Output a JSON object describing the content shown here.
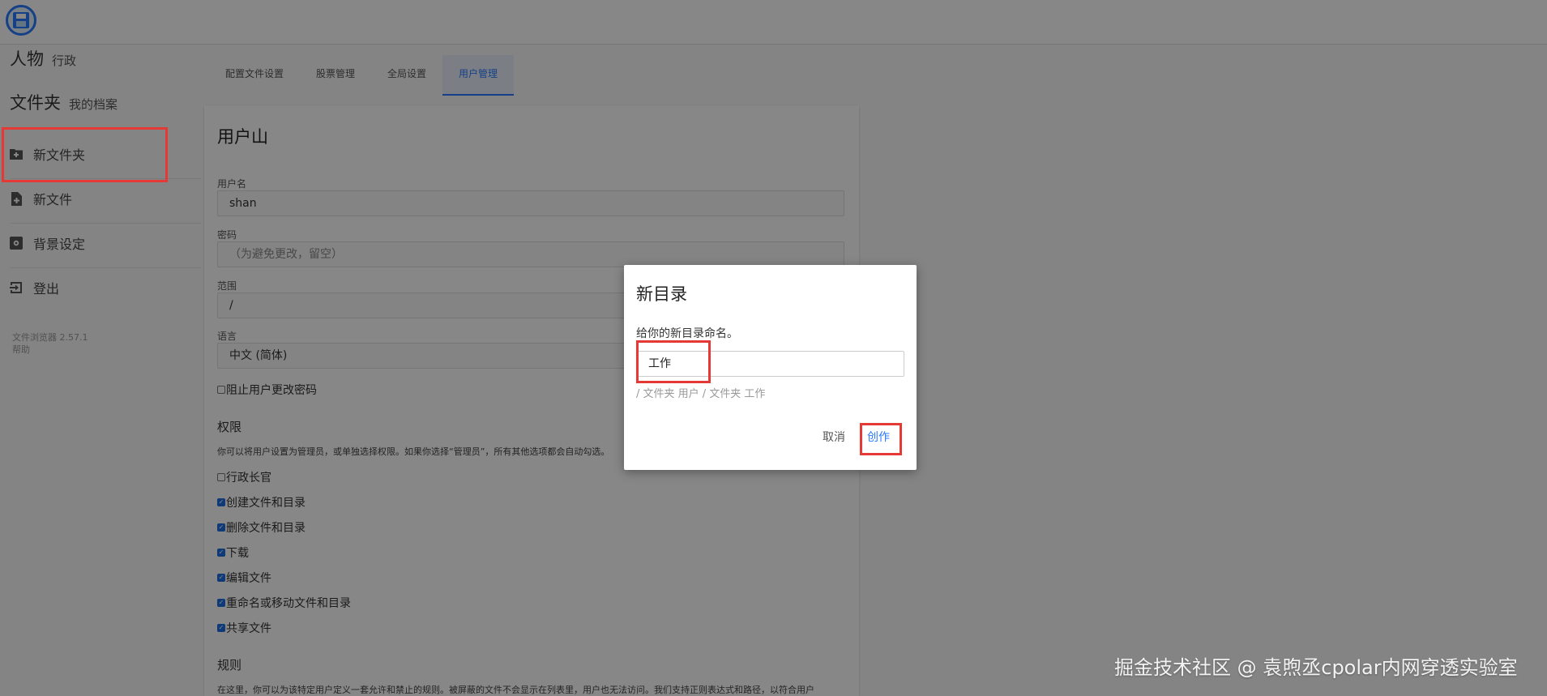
{
  "sidebar": {
    "people_label": "人物",
    "people_value": "行政",
    "folder_label": "文件夹",
    "folder_value": "我的档案",
    "items": [
      {
        "label": "新文件夹",
        "icon": "new-folder-icon"
      },
      {
        "label": "新文件",
        "icon": "new-file-icon"
      },
      {
        "label": "背景设定",
        "icon": "settings-icon"
      },
      {
        "label": "登出",
        "icon": "logout-icon"
      }
    ],
    "version": "文件浏览器 2.57.1",
    "help": "帮助"
  },
  "tabs": [
    {
      "label": "配置文件设置",
      "active": false
    },
    {
      "label": "股票管理",
      "active": false
    },
    {
      "label": "全局设置",
      "active": false
    },
    {
      "label": "用户管理",
      "active": true
    }
  ],
  "user_form": {
    "title": "用户山",
    "username_label": "用户名",
    "username_value": "shan",
    "password_label": "密码",
    "password_placeholder": "（为避免更改，留空）",
    "scope_label": "范围",
    "scope_value": "/",
    "language_label": "语言",
    "language_value": "中文 (简体)",
    "prevent_password_change": "阻止用户更改密码",
    "permissions_title": "权限",
    "permissions_desc": "你可以将用户设置为管理员，或单独选择权限。如果你选择“管理员”，所有其他选项都会自动勾选。",
    "permissions": [
      {
        "label": "行政长官",
        "checked": false
      },
      {
        "label": "创建文件和目录",
        "checked": true
      },
      {
        "label": "删除文件和目录",
        "checked": true
      },
      {
        "label": "下载",
        "checked": true
      },
      {
        "label": "编辑文件",
        "checked": true
      },
      {
        "label": "重命名或移动文件和目录",
        "checked": true
      },
      {
        "label": "共享文件",
        "checked": true
      }
    ],
    "rules_title": "规则",
    "rules_desc": "在这里，你可以为该特定用户定义一套允许和禁止的规则。被屏蔽的文件不会显示在列表里，用户也无法访问。我们支持正则表达式和路径，以符合用户"
  },
  "dialog": {
    "title": "新目录",
    "description": "给你的新目录命名。",
    "input_value": "工作",
    "path": "/ 文件夹 用户 / 文件夹 工作",
    "cancel_label": "取消",
    "create_label": "创作"
  },
  "watermark": "掘金技术社区 @ 袁煦丞cpolar内网穿透实验室",
  "colors": {
    "accent": "#2979ff",
    "annotation": "#e53935",
    "checkbox": "#1e6fe0"
  }
}
